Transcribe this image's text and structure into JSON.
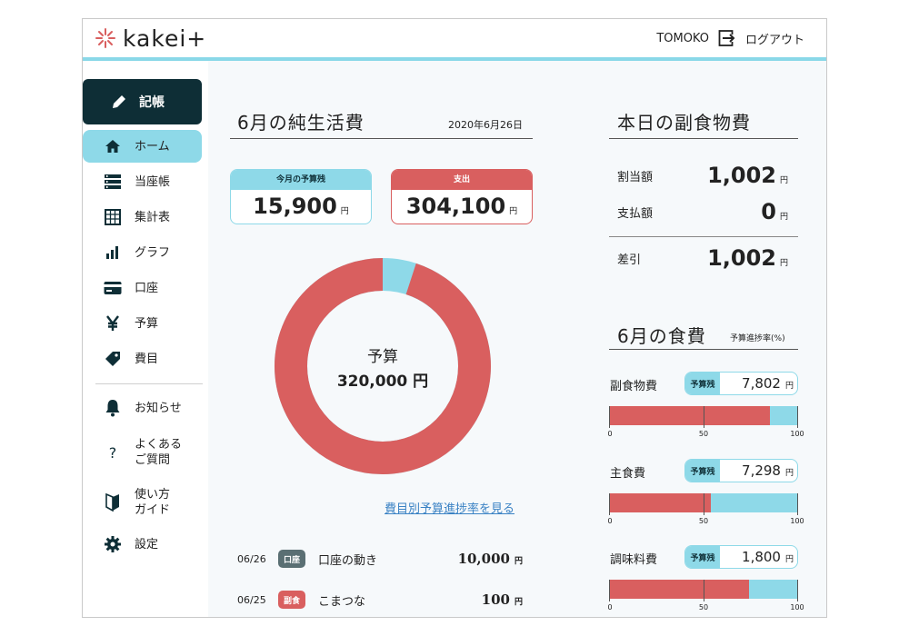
{
  "colors": {
    "navy": "#0e2e36",
    "aqua": "#8ed9e8",
    "red": "#d95f5f",
    "link": "#3a82c4"
  },
  "header": {
    "brand": "kakei+",
    "user": "TOMOKO",
    "logout": "ログアウト"
  },
  "sidebar": {
    "entry": "記帳",
    "items": [
      {
        "label": "ホーム",
        "icon": "home-icon"
      },
      {
        "label": "当座帳",
        "icon": "list-icon"
      },
      {
        "label": "集計表",
        "icon": "table-icon"
      },
      {
        "label": "グラフ",
        "icon": "bar-chart-icon"
      },
      {
        "label": "口座",
        "icon": "card-icon"
      },
      {
        "label": "予算",
        "icon": "yen-icon"
      },
      {
        "label": "費目",
        "icon": "tag-icon"
      },
      {
        "label": "お知らせ",
        "icon": "bell-icon"
      },
      {
        "label_1": "よくある",
        "label_2": "ご質問",
        "icon": "question-icon"
      },
      {
        "label_1": "使い方",
        "label_2": "ガイド",
        "icon": "beginner-icon"
      },
      {
        "label": "設定",
        "icon": "gear-icon"
      }
    ]
  },
  "living": {
    "title": "6月の純生活費",
    "date": "2020年6月26日",
    "budget_remaining_label": "今月の予算残",
    "budget_remaining": "15,900",
    "spent_label": "支出",
    "spent": "304,100",
    "yen": "円",
    "donut_label": "予算",
    "donut_value": "320,000 円",
    "spent_share": 0.95,
    "link": "費目別予算進捗率を見る"
  },
  "transactions": [
    {
      "date": "06/26",
      "tag": "口座",
      "tag_color": "#5a6f73",
      "desc": "口座の動き",
      "amount": "10,000",
      "unit": "円"
    },
    {
      "date": "06/25",
      "tag": "副食",
      "tag_color": "#d95f5f",
      "desc": "こまつな",
      "amount": "100",
      "unit": "円"
    }
  ],
  "sidefood": {
    "title": "本日の副食物費",
    "allotted_label": "割当額",
    "allotted": "1,002",
    "paid_label": "支払額",
    "paid": "0",
    "diff_label": "差引",
    "diff": "1,002",
    "yen": "円"
  },
  "food": {
    "title": "6月の食費",
    "note": "予算進捗率(%)",
    "remain_tag": "予算残",
    "yen": "円",
    "ticks": [
      "0",
      "50",
      "100"
    ],
    "categories": [
      {
        "name": "副食物費",
        "remaining": "7,802",
        "progress": 0.85
      },
      {
        "name": "主食費",
        "remaining": "7,298",
        "progress": 0.54
      },
      {
        "name": "調味料費",
        "remaining": "1,800",
        "progress": 0.74
      }
    ]
  }
}
